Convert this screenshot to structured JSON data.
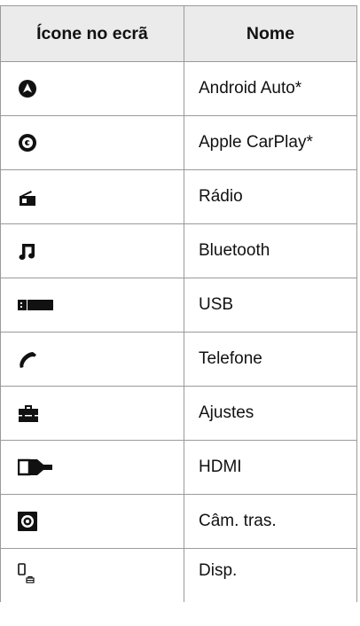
{
  "table": {
    "headers": {
      "icon": "Ícone no ecrã",
      "name": "Nome"
    },
    "rows": [
      {
        "icon": "android-auto-icon",
        "name": "Android Auto*"
      },
      {
        "icon": "apple-carplay-icon",
        "name": "Apple CarPlay*"
      },
      {
        "icon": "radio-icon",
        "name": "Rádio"
      },
      {
        "icon": "bluetooth-music-icon",
        "name": "Bluetooth"
      },
      {
        "icon": "usb-icon",
        "name": "USB"
      },
      {
        "icon": "phone-icon",
        "name": "Telefone"
      },
      {
        "icon": "settings-toolbox-icon",
        "name": "Ajustes"
      },
      {
        "icon": "hdmi-icon",
        "name": "HDMI"
      },
      {
        "icon": "rear-camera-icon",
        "name": "Câm. tras."
      },
      {
        "icon": "device-icon",
        "name": "Disp."
      }
    ]
  }
}
